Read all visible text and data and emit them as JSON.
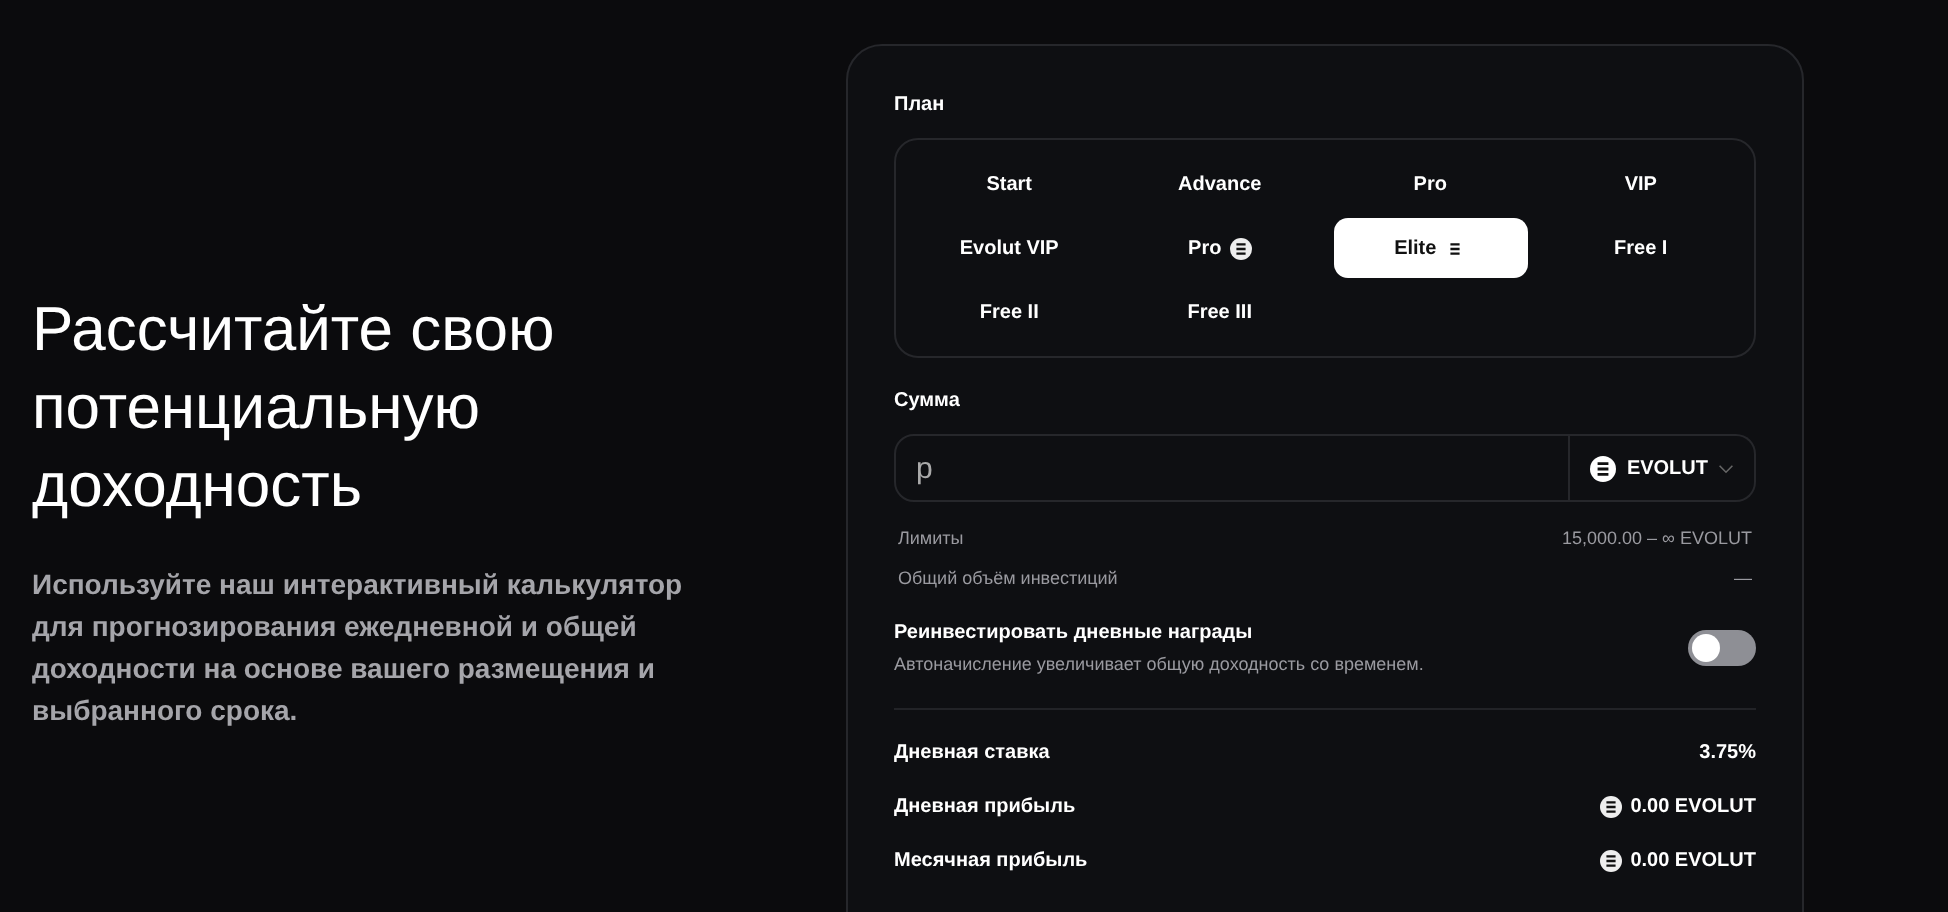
{
  "hero": {
    "title": "Рассчитайте свою потенциальную доходность",
    "text": "Используйте наш интерактивный калькулятор для прогнозирования ежедневной и общей доходности на основе вашего размещения и выбранного срока."
  },
  "plan": {
    "label": "План",
    "options": [
      {
        "label": "Start",
        "selected": false,
        "kind": "plain"
      },
      {
        "label": "Advance",
        "selected": false,
        "kind": "plain"
      },
      {
        "label": "Pro",
        "selected": false,
        "kind": "plain"
      },
      {
        "label": "VIP",
        "selected": false,
        "kind": "plain"
      },
      {
        "label": "Evolut VIP",
        "selected": false,
        "kind": "plain"
      },
      {
        "label": "Pro",
        "selected": false,
        "kind": "token"
      },
      {
        "label": "Elite",
        "selected": true,
        "kind": "token"
      },
      {
        "label": "Free I",
        "selected": false,
        "kind": "plain"
      },
      {
        "label": "Free II",
        "selected": false,
        "kind": "plain"
      },
      {
        "label": "Free III",
        "selected": false,
        "kind": "plain"
      }
    ]
  },
  "amount": {
    "label": "Сумма",
    "value": "р",
    "currency": "EVOLUT"
  },
  "info": [
    {
      "label": "Лимиты",
      "value": "15,000.00 – ∞ EVOLUT"
    },
    {
      "label": "Общий объём инвестиций",
      "value": "—"
    }
  ],
  "reinvest": {
    "title": "Реинвестировать дневные награды",
    "hint": "Автоначисление увеличивает общую доходность со временем.",
    "on": false
  },
  "results": [
    {
      "label": "Дневная ставка",
      "value": "3.75%",
      "kind": "plain"
    },
    {
      "label": "Дневная прибыль",
      "value": "0.00 EVOLUT",
      "kind": "token"
    },
    {
      "label": "Месячная прибыль",
      "value": "0.00 EVOLUT",
      "kind": "token"
    }
  ]
}
